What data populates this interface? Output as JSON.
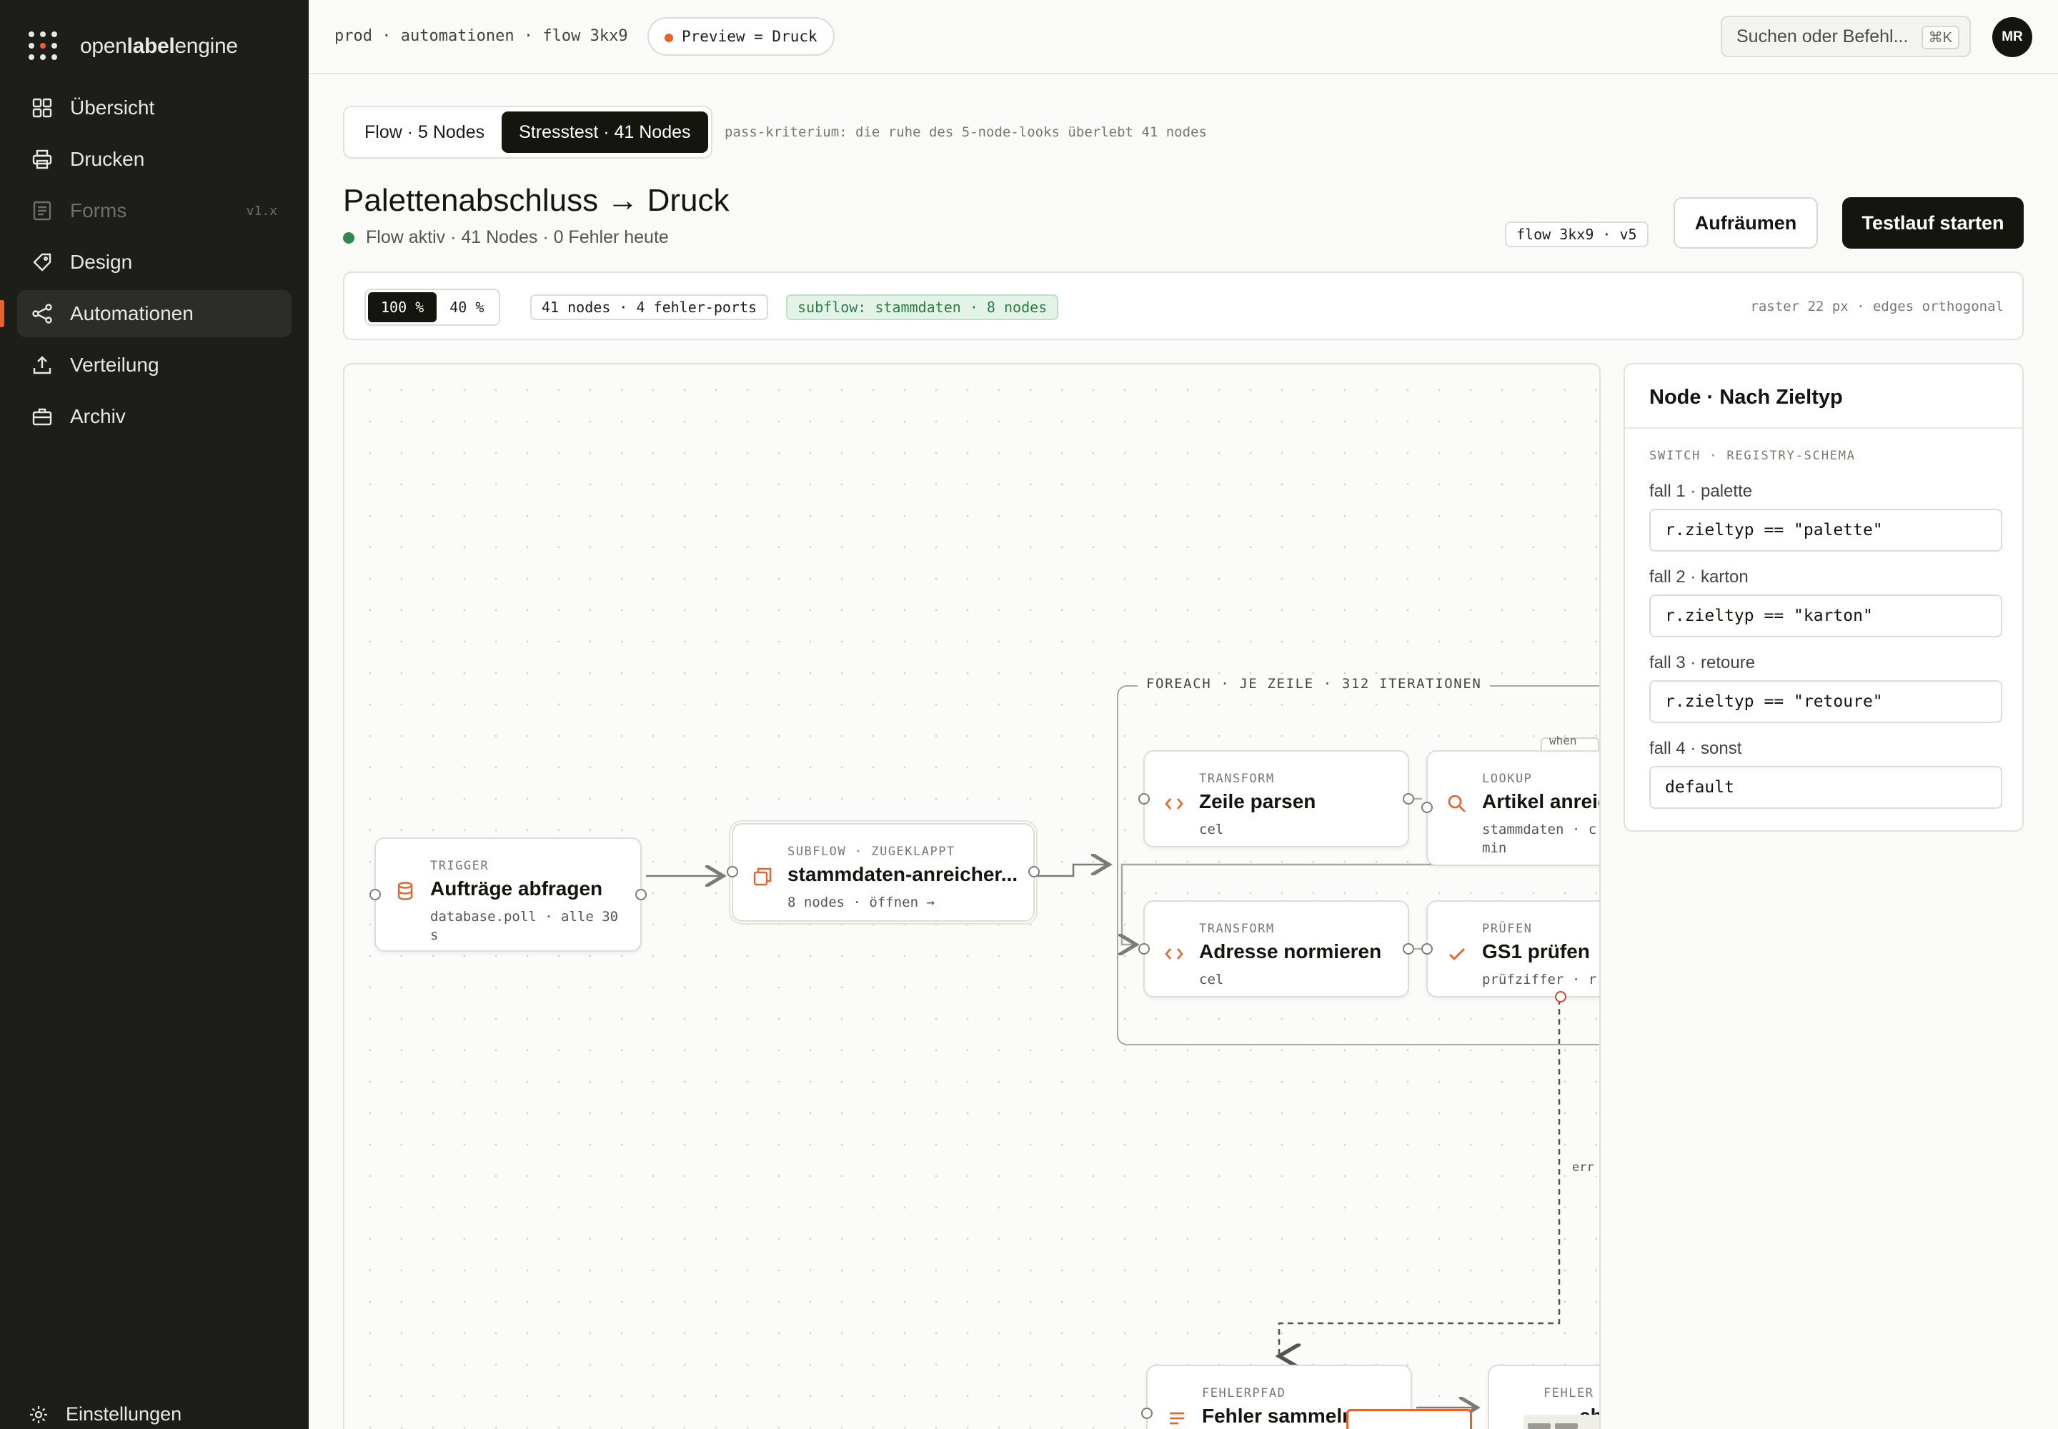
{
  "app": {
    "logo_open": "open",
    "logo_label": "label",
    "logo_engine": "engine",
    "accent": "#e8622c"
  },
  "sidebar": {
    "items": [
      {
        "label": "Übersicht",
        "icon": "grid-icon"
      },
      {
        "label": "Drucken",
        "icon": "printer-icon"
      },
      {
        "label": "Forms",
        "icon": "form-icon",
        "badge": "v1.x"
      },
      {
        "label": "Design",
        "icon": "tag-icon"
      },
      {
        "label": "Automationen",
        "icon": "share-nodes-icon"
      },
      {
        "label": "Verteilung",
        "icon": "upload-icon"
      },
      {
        "label": "Archiv",
        "icon": "briefcase-icon"
      }
    ],
    "settings_label": "Einstellungen"
  },
  "topbar": {
    "breadcrumb": "prod · automationen · flow 3kx9",
    "preview_label": "Preview = Druck",
    "search_placeholder": "Suchen oder Befehl...",
    "search_shortcut": "⌘K",
    "avatar_initials": "MR"
  },
  "modes": {
    "flow_label": "Flow · 5 Nodes",
    "stress_label": "Stresstest · 41 Nodes",
    "criterion": "pass-kriterium: die ruhe des 5-node-looks überlebt 41 nodes"
  },
  "header": {
    "title": "Palettenabschluss → Druck",
    "status": "Flow aktiv · 41 Nodes · 0 Fehler heute",
    "flow_tag": "flow 3kx9 · v5",
    "clean_button": "Aufräumen",
    "run_button": "Testlauf starten"
  },
  "toolbar": {
    "zoom_100": "100 %",
    "zoom_40": "40 %",
    "node_count": "41 nodes · 4 fehler-ports",
    "subflow": "subflow: stammdaten · 8 nodes",
    "raster": "raster 22 px · edges orthogonal"
  },
  "canvas": {
    "foreach_label": "FOREACH · JE ZEILE · 312 ITERATIONEN",
    "when_label": "when r.",
    "err_label": "err",
    "nodes": {
      "trigger": {
        "kind": "TRIGGER",
        "name": "Aufträge abfragen",
        "sub": "database.poll · alle 30 s"
      },
      "subflow": {
        "kind": "SUBFLOW · ZUGEKLAPPT",
        "name": "stammdaten-anreicher...",
        "sub": "8 nodes · öffnen →"
      },
      "parse": {
        "kind": "TRANSFORM",
        "name": "Zeile parsen",
        "sub": "cel"
      },
      "lookup": {
        "kind": "LOOKUP",
        "name": "Artikel anreich",
        "sub": "stammdaten · c min"
      },
      "normalize": {
        "kind": "TRANSFORM",
        "name": "Adresse normieren",
        "sub": "cel"
      },
      "check": {
        "kind": "PRÜFEN",
        "name": "GS1 prüfen",
        "sub": "prüfziffer · r"
      },
      "errors": {
        "kind": "FEHLERPFAD",
        "name": "Fehler sammeln"
      },
      "errors2": {
        "kind": "FEHLER",
        "name": "ch"
      }
    }
  },
  "inspector": {
    "title": "Node · Nach Zieltyp",
    "kind": "SWITCH · REGISTRY-SCHEMA",
    "cases": [
      {
        "label": "fall 1 · palette",
        "expr": "r.zieltyp == \"palette\""
      },
      {
        "label": "fall 2 · karton",
        "expr": "r.zieltyp == \"karton\""
      },
      {
        "label": "fall 3 · retoure",
        "expr": "r.zieltyp == \"retoure\""
      },
      {
        "label": "fall 4 · sonst",
        "expr": "default"
      }
    ]
  }
}
